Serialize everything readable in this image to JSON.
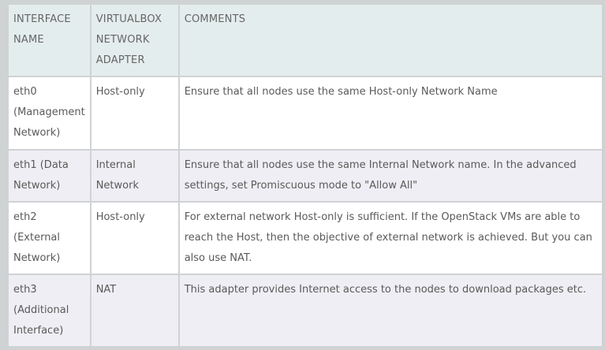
{
  "table": {
    "headers": [
      "INTERFACE NAME",
      "VIRTUALBOX NETWORK ADAPTER",
      "COMMENTS"
    ],
    "rows": [
      {
        "interface": "eth0 (Management Network)",
        "adapter": "Host-only",
        "comment": "Ensure that all nodes use the same Host-only Network Name"
      },
      {
        "interface": "eth1 (Data Network)",
        "adapter": "Internal Network",
        "comment": "Ensure that all nodes use the same Internal Network name. In the advanced settings, set Promiscuous mode to \"Allow All\""
      },
      {
        "interface": "eth2 (External Network)",
        "adapter": "Host-only",
        "comment": "For external network Host-only is sufficient. If the OpenStack VMs are able to reach the Host, then the objective of external network is achieved. But you can also use NAT."
      },
      {
        "interface": "eth3 (Additional Interface)",
        "adapter": "NAT",
        "comment": "This adapter provides Internet access to the nodes to download packages etc."
      }
    ]
  }
}
